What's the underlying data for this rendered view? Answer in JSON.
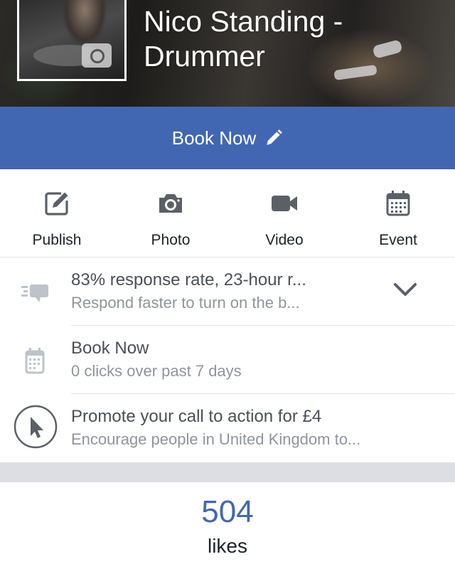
{
  "header": {
    "title_line1": "Nico Standing -",
    "title_line2": "Drummer"
  },
  "cta": {
    "label": "Book Now",
    "edit_icon": "pencil-icon"
  },
  "actions": [
    {
      "label": "Publish",
      "icon": "edit-icon"
    },
    {
      "label": "Photo",
      "icon": "camera-icon"
    },
    {
      "label": "Video",
      "icon": "video-camera-icon"
    },
    {
      "label": "Event",
      "icon": "calendar-icon"
    }
  ],
  "insights": [
    {
      "title": "83% response rate, 23-hour r...",
      "subtitle": "Respond faster to turn on the b...",
      "icon": "message-bubble-icon"
    },
    {
      "title": "Book Now",
      "subtitle": "0 clicks over past 7 days",
      "icon": "calendar-icon"
    },
    {
      "title": "Promote your call to action for £4",
      "subtitle": "Encourage people in United Kingdom to...",
      "icon": "cursor-icon"
    }
  ],
  "likes": {
    "count": "504",
    "label": "likes"
  },
  "colors": {
    "brand_blue": "#4267b2",
    "icon_gray": "#5b6067",
    "light_icon_gray": "#bec2c9",
    "separator": "#e3e4e6",
    "band": "#dcdee3"
  }
}
